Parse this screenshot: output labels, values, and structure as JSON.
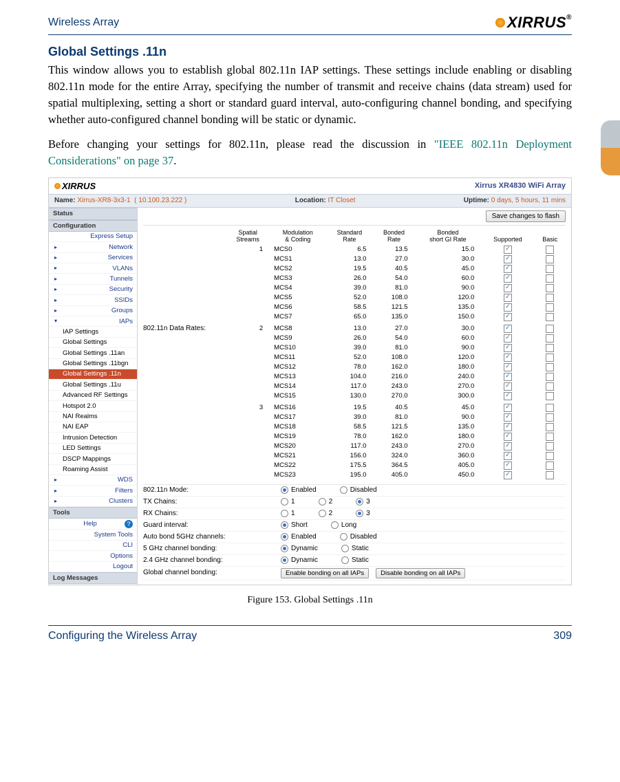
{
  "page": {
    "header_left": "Wireless Array",
    "logo_text": "XIRRUS",
    "section_title": "Global Settings .11n",
    "para1": "This window allows you to establish global 802.11n IAP settings. These settings include enabling or disabling 802.11n mode for the entire Array, specifying the number of transmit and receive chains (data stream) used for spatial multiplexing, setting a short or standard guard interval, auto-configuring channel bonding, and specifying whether auto-configured channel bonding will be static or dynamic.",
    "para2_a": "Before changing your settings for 802.11n, please read the discussion in ",
    "para2_link": "\"IEEE 802.11n Deployment Considerations\" on page 37",
    "para2_b": ".",
    "caption": "Figure 153. Global Settings .11n",
    "footer_left": "Configuring the Wireless Array",
    "footer_right": "309"
  },
  "screenshot": {
    "device_title": "Xirrus XR4830 WiFi Array",
    "logo": "XIRRUS",
    "info": {
      "name_label": "Name:",
      "name_val": "Xirrus-XR8-3x3-1",
      "name_ip": "( 10.100.23.222 )",
      "loc_label": "Location:",
      "loc_val": "IT Closet",
      "up_label": "Uptime:",
      "up_val": "0 days, 5 hours, 11 mins"
    },
    "save_btn": "Save changes to flash",
    "sidebar": {
      "status": "Status",
      "config": "Configuration",
      "items_top": [
        "Express Setup",
        "Network",
        "Services",
        "VLANs",
        "Tunnels",
        "Security",
        "SSIDs",
        "Groups",
        "IAPs"
      ],
      "iap_subs": [
        "IAP Settings",
        "Global Settings",
        "Global Settings .11an",
        "Global Settings .11bgn",
        "Global Settings .11n",
        "Global Settings .11u",
        "Advanced RF Settings",
        "Hotspot 2.0",
        "NAI Realms",
        "NAI EAP",
        "Intrusion Detection",
        "LED Settings",
        "DSCP Mappings",
        "Roaming Assist"
      ],
      "items_bottom": [
        "WDS",
        "Filters",
        "Clusters"
      ],
      "tools": "Tools",
      "tool_items": [
        "Help",
        "System Tools",
        "CLI",
        "Options",
        "Logout"
      ],
      "logs": "Log Messages"
    },
    "table": {
      "row_label": "802.11n Data Rates:",
      "headers": [
        "Spatial Streams",
        "Modulation & Coding",
        "Standard Rate",
        "Bonded Rate",
        "Bonded short GI Rate",
        "Supported",
        "Basic"
      ],
      "groups": [
        {
          "ss": 1,
          "rows": [
            {
              "mcs": "MCS0",
              "std": 6.5,
              "bond": 13.5,
              "sgi": 15.0,
              "sup": true,
              "bas": false
            },
            {
              "mcs": "MCS1",
              "std": 13.0,
              "bond": 27.0,
              "sgi": 30.0,
              "sup": true,
              "bas": false
            },
            {
              "mcs": "MCS2",
              "std": 19.5,
              "bond": 40.5,
              "sgi": 45.0,
              "sup": true,
              "bas": false
            },
            {
              "mcs": "MCS3",
              "std": 26.0,
              "bond": 54.0,
              "sgi": 60.0,
              "sup": true,
              "bas": false
            },
            {
              "mcs": "MCS4",
              "std": 39.0,
              "bond": 81.0,
              "sgi": 90.0,
              "sup": true,
              "bas": false
            },
            {
              "mcs": "MCS5",
              "std": 52.0,
              "bond": 108.0,
              "sgi": 120.0,
              "sup": true,
              "bas": false
            },
            {
              "mcs": "MCS6",
              "std": 58.5,
              "bond": 121.5,
              "sgi": 135.0,
              "sup": true,
              "bas": false
            },
            {
              "mcs": "MCS7",
              "std": 65.0,
              "bond": 135.0,
              "sgi": 150.0,
              "sup": true,
              "bas": false
            }
          ]
        },
        {
          "ss": 2,
          "rows": [
            {
              "mcs": "MCS8",
              "std": 13.0,
              "bond": 27.0,
              "sgi": 30.0,
              "sup": true,
              "bas": false
            },
            {
              "mcs": "MCS9",
              "std": 26.0,
              "bond": 54.0,
              "sgi": 60.0,
              "sup": true,
              "bas": false
            },
            {
              "mcs": "MCS10",
              "std": 39.0,
              "bond": 81.0,
              "sgi": 90.0,
              "sup": true,
              "bas": false
            },
            {
              "mcs": "MCS11",
              "std": 52.0,
              "bond": 108.0,
              "sgi": 120.0,
              "sup": true,
              "bas": false
            },
            {
              "mcs": "MCS12",
              "std": 78.0,
              "bond": 162.0,
              "sgi": 180.0,
              "sup": true,
              "bas": false
            },
            {
              "mcs": "MCS13",
              "std": 104.0,
              "bond": 216.0,
              "sgi": 240.0,
              "sup": true,
              "bas": false
            },
            {
              "mcs": "MCS14",
              "std": 117.0,
              "bond": 243.0,
              "sgi": 270.0,
              "sup": true,
              "bas": false
            },
            {
              "mcs": "MCS15",
              "std": 130.0,
              "bond": 270.0,
              "sgi": 300.0,
              "sup": true,
              "bas": false
            }
          ]
        },
        {
          "ss": 3,
          "rows": [
            {
              "mcs": "MCS16",
              "std": 19.5,
              "bond": 40.5,
              "sgi": 45.0,
              "sup": true,
              "bas": false
            },
            {
              "mcs": "MCS17",
              "std": 39.0,
              "bond": 81.0,
              "sgi": 90.0,
              "sup": true,
              "bas": false
            },
            {
              "mcs": "MCS18",
              "std": 58.5,
              "bond": 121.5,
              "sgi": 135.0,
              "sup": true,
              "bas": false
            },
            {
              "mcs": "MCS19",
              "std": 78.0,
              "bond": 162.0,
              "sgi": 180.0,
              "sup": true,
              "bas": false
            },
            {
              "mcs": "MCS20",
              "std": 117.0,
              "bond": 243.0,
              "sgi": 270.0,
              "sup": true,
              "bas": false
            },
            {
              "mcs": "MCS21",
              "std": 156.0,
              "bond": 324.0,
              "sgi": 360.0,
              "sup": true,
              "bas": false
            },
            {
              "mcs": "MCS22",
              "std": 175.5,
              "bond": 364.5,
              "sgi": 405.0,
              "sup": true,
              "bas": false
            },
            {
              "mcs": "MCS23",
              "std": 195.0,
              "bond": 405.0,
              "sgi": 450.0,
              "sup": true,
              "bas": false
            }
          ]
        }
      ]
    },
    "settings": [
      {
        "label": "802.11n Mode:",
        "opts": [
          {
            "t": "Enabled",
            "sel": true
          },
          {
            "t": "Disabled",
            "sel": false
          }
        ]
      },
      {
        "label": "TX Chains:",
        "opts": [
          {
            "t": "1",
            "sel": false
          },
          {
            "t": "2",
            "sel": false
          },
          {
            "t": "3",
            "sel": true
          }
        ]
      },
      {
        "label": "RX Chains:",
        "opts": [
          {
            "t": "1",
            "sel": false
          },
          {
            "t": "2",
            "sel": false
          },
          {
            "t": "3",
            "sel": true
          }
        ]
      },
      {
        "label": "Guard interval:",
        "opts": [
          {
            "t": "Short",
            "sel": true
          },
          {
            "t": "Long",
            "sel": false
          }
        ]
      },
      {
        "label": "Auto bond 5GHz channels:",
        "opts": [
          {
            "t": "Enabled",
            "sel": true
          },
          {
            "t": "Disabled",
            "sel": false
          }
        ]
      },
      {
        "label": "5 GHz channel bonding:",
        "opts": [
          {
            "t": "Dynamic",
            "sel": true
          },
          {
            "t": "Static",
            "sel": false
          }
        ]
      },
      {
        "label": "2.4 GHz channel bonding:",
        "opts": [
          {
            "t": "Dynamic",
            "sel": true
          },
          {
            "t": "Static",
            "sel": false
          }
        ]
      }
    ],
    "global_bond": {
      "label": "Global channel bonding:",
      "btn1": "Enable bonding on all IAPs",
      "btn2": "Disable bonding on all IAPs"
    }
  }
}
